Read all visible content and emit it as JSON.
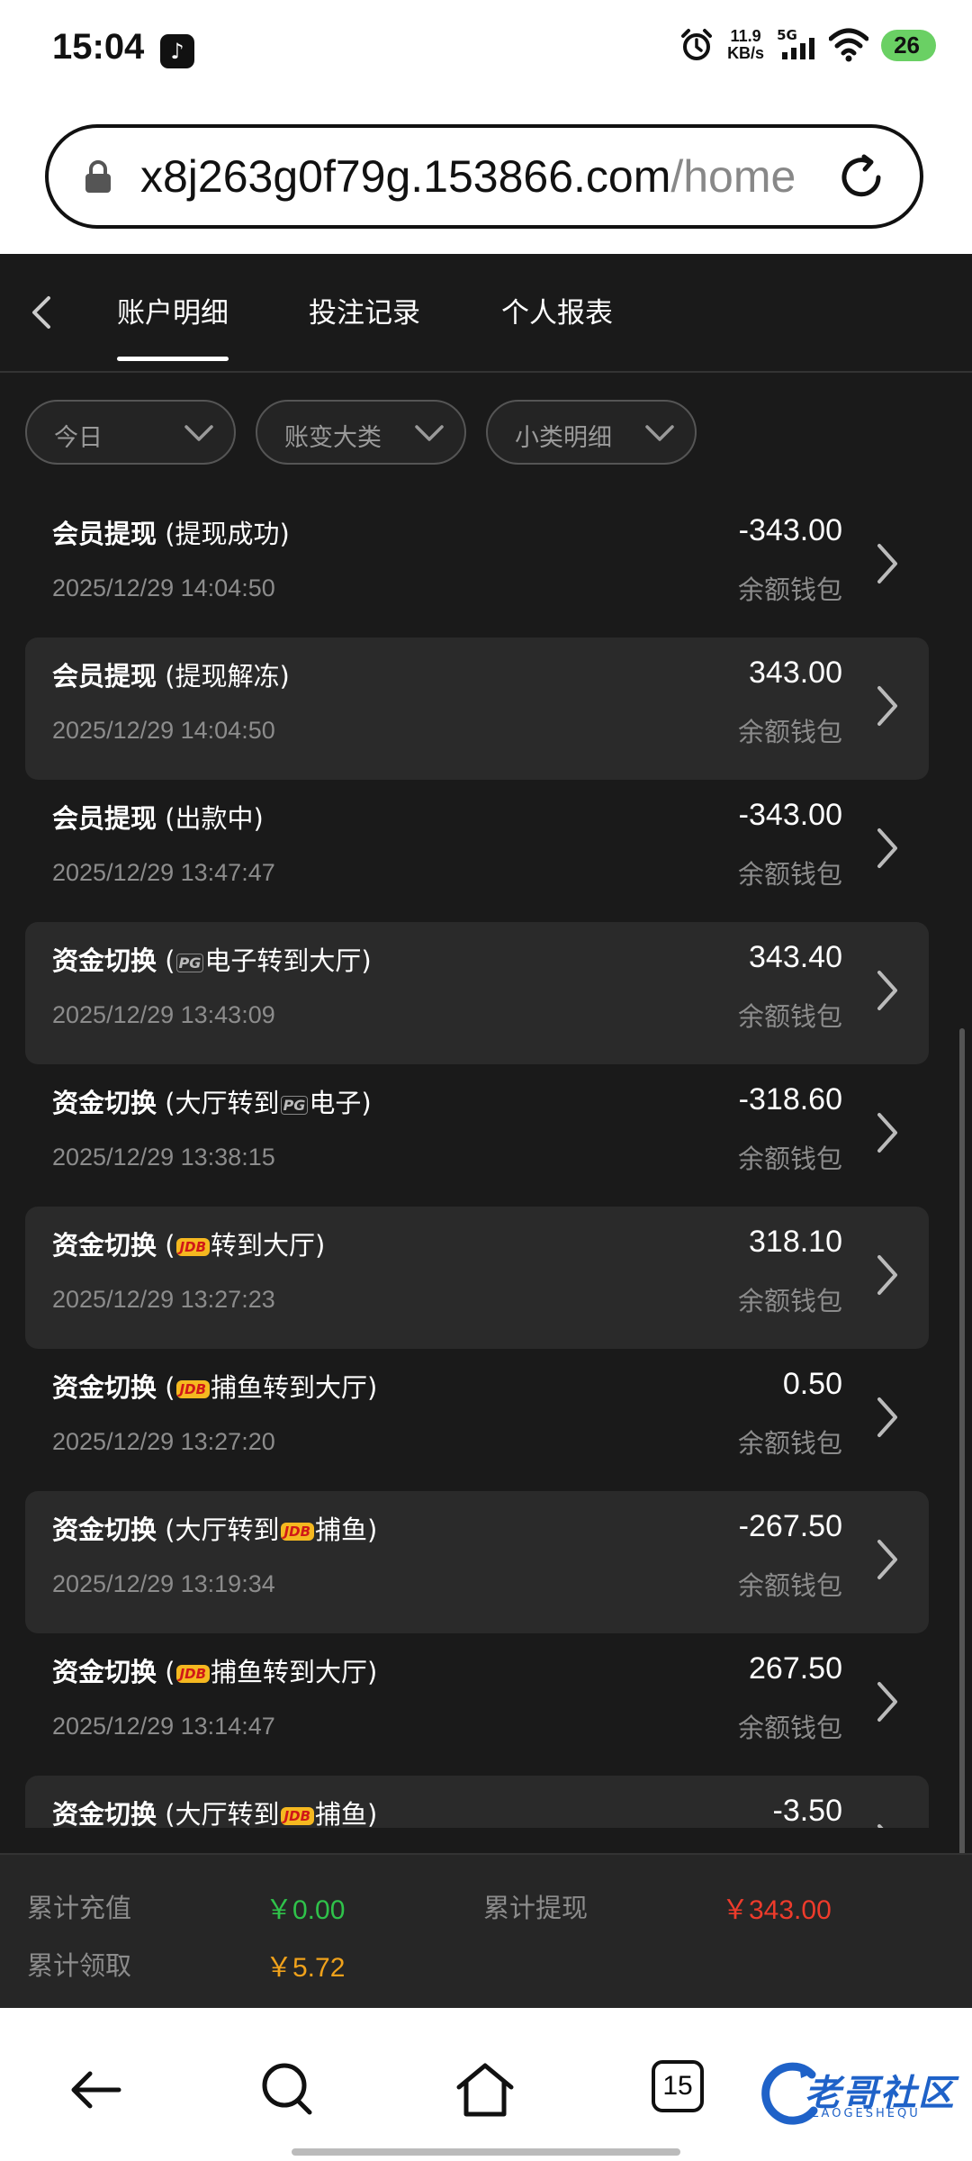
{
  "status_bar": {
    "time": "15:04",
    "net_speed_value": "11.9",
    "net_speed_unit": "KB/s",
    "network": "5G",
    "battery": "26"
  },
  "browser": {
    "url_domain": "x8j263g0f79g.153866.com",
    "url_path": "/home"
  },
  "tabs": [
    {
      "label": "账户明细",
      "active": true
    },
    {
      "label": "投注记录",
      "active": false
    },
    {
      "label": "个人报表",
      "active": false
    }
  ],
  "filters": [
    {
      "label": "今日"
    },
    {
      "label": "账变大类"
    },
    {
      "label": "小类明细"
    }
  ],
  "records": [
    {
      "category": "会员提现",
      "detail_pre": "(提现成功)",
      "icon": "",
      "detail_post": "",
      "date": "2025/12/29 14:04:50",
      "amount": "-343.00",
      "wallet": "余额钱包"
    },
    {
      "category": "会员提现",
      "detail_pre": "(提现解冻)",
      "icon": "",
      "detail_post": "",
      "date": "2025/12/29 14:04:50",
      "amount": "343.00",
      "wallet": "余额钱包"
    },
    {
      "category": "会员提现",
      "detail_pre": "(出款中)",
      "icon": "",
      "detail_post": "",
      "date": "2025/12/29 13:47:47",
      "amount": "-343.00",
      "wallet": "余额钱包"
    },
    {
      "category": "资金切换",
      "detail_pre": "(",
      "icon": "PG",
      "detail_post": "电子转到大厅)",
      "date": "2025/12/29 13:43:09",
      "amount": "343.40",
      "wallet": "余额钱包"
    },
    {
      "category": "资金切换",
      "detail_pre": "(大厅转到",
      "icon": "PG",
      "detail_post": "电子)",
      "date": "2025/12/29 13:38:15",
      "amount": "-318.60",
      "wallet": "余额钱包"
    },
    {
      "category": "资金切换",
      "detail_pre": "(",
      "icon": "JDB",
      "detail_post": "转到大厅)",
      "date": "2025/12/29 13:27:23",
      "amount": "318.10",
      "wallet": "余额钱包"
    },
    {
      "category": "资金切换",
      "detail_pre": "(",
      "icon": "JDB",
      "detail_post": "捕鱼转到大厅)",
      "date": "2025/12/29 13:27:20",
      "amount": "0.50",
      "wallet": "余额钱包"
    },
    {
      "category": "资金切换",
      "detail_pre": "(大厅转到",
      "icon": "JDB",
      "detail_post": "捕鱼)",
      "date": "2025/12/29 13:19:34",
      "amount": "-267.50",
      "wallet": "余额钱包"
    },
    {
      "category": "资金切换",
      "detail_pre": "(",
      "icon": "JDB",
      "detail_post": "捕鱼转到大厅)",
      "date": "2025/12/29 13:14:47",
      "amount": "267.50",
      "wallet": "余额钱包"
    },
    {
      "category": "资金切换",
      "detail_pre": "(大厅转到",
      "icon": "JDB",
      "detail_post": "捕鱼)",
      "date": "",
      "amount": "-3.50",
      "wallet": ""
    }
  ],
  "summary": {
    "deposit_label": "累计充值",
    "deposit_value": "￥0.00",
    "withdraw_label": "累计提现",
    "withdraw_value": "￥343.00",
    "claim_label": "累计领取",
    "claim_value": "￥5.72"
  },
  "bottom_nav": {
    "tab_count": "15",
    "watermark": "老哥社区",
    "watermark_sub": "LAOGESHEQU"
  },
  "colors": {
    "background": "#1a1a1a",
    "card_alt": "#2a2a2a",
    "deposit_green": "#2fc24a",
    "withdraw_red": "#ee3b2b",
    "claim_orange": "#f0a21b"
  }
}
